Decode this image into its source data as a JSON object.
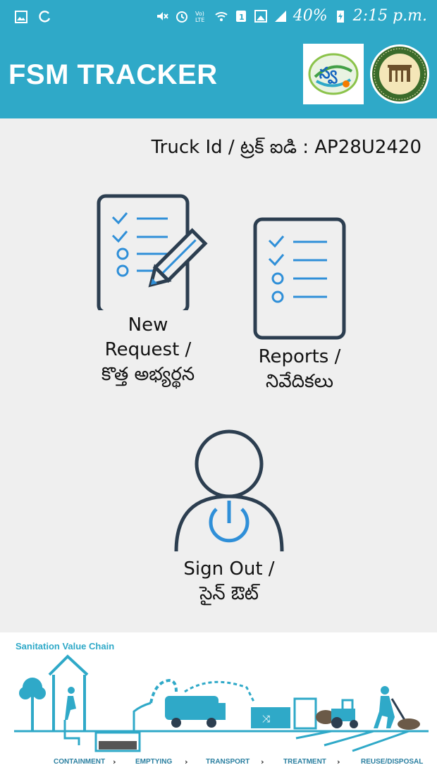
{
  "status_bar": {
    "battery": "40%",
    "time": "2:15 p.m.",
    "icons": [
      "image-icon",
      "circle-arrow-icon",
      "mute-icon",
      "alarm-icon",
      "volte-icon",
      "wifi-icon",
      "sim-icon",
      "screenshot-icon",
      "signal-icon",
      "battery-charging-icon"
    ]
  },
  "header": {
    "title": "FSM TRACKER"
  },
  "truck_id": "Truck Id / ట్రక్ ఐడి : AP28U2420",
  "actions": {
    "new_request": {
      "line1": "New",
      "line2": "Request /",
      "line3": "కొత్త అభ్యర్థన"
    },
    "reports": {
      "line1": "Reports /",
      "line2": "నివేదికలు"
    },
    "sign_out": {
      "line1": "Sign Out /",
      "line2": "సైన్ ఔట్"
    }
  },
  "sanitation": {
    "title": "Sanitation Value Chain",
    "steps": [
      "CONTAINMENT",
      "EMPTYING",
      "TRANSPORT",
      "TREATMENT",
      "REUSE/DISPOSAL"
    ]
  },
  "colors": {
    "primary": "#2fa9c8",
    "icon_dark": "#2c3e50",
    "icon_blue": "#2f8fd8"
  }
}
